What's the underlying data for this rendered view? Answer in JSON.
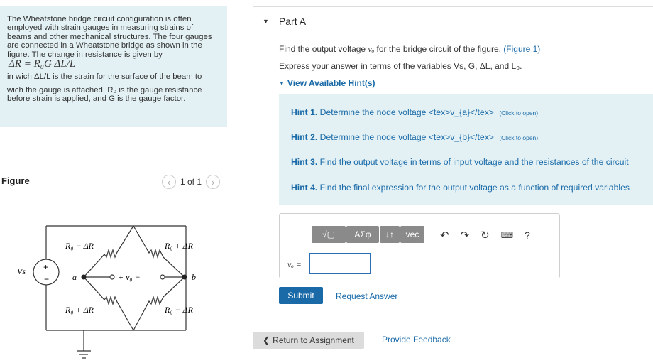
{
  "intro": {
    "lines": [
      "The Wheatstone bridge circuit configuration is often",
      "employed with strain gauges in measuring strains of",
      "beams and other mechanical structures. The four gauges",
      "are connected in a Wheatstone bridge as shown in the",
      "figure. The change in resistance is given by"
    ],
    "formula": "ΔR = R₀G ΔL/L",
    "after_formula": "in wich ΔL/L is the strain for the surface of the beam to",
    "lines2": [
      "wich the gauge is attached, R₀ is the gauge resistance",
      "before strain is applied, and G is the gauge factor."
    ]
  },
  "figure": {
    "label": "Figure",
    "pager": "1 of 1",
    "resistor_labels": [
      "R₀ − ΔR",
      "R₀ + ΔR",
      "R₀ + ΔR",
      "R₀ − ΔR"
    ],
    "node_a": "a",
    "node_b": "b",
    "vs": "Vs",
    "vo_label": "+ v₀ −"
  },
  "partA": {
    "title": "Part A",
    "question_pre": "Find the output voltage ",
    "question_var": "vₒ",
    "question_post": " for the bridge circuit of the figure. ",
    "figure_link": "(Figure 1)",
    "express": "Express your answer in terms of the variables Vs, G, ΔL, and L₀.",
    "hints_toggle": "View Available Hint(s)",
    "hints": [
      {
        "num": "Hint 1.",
        "text": "Determine the node voltage <tex>v_{a}</tex>",
        "note": "(Click to open)"
      },
      {
        "num": "Hint 2.",
        "text": "Determine the node voltage <tex>v_{b}</tex>",
        "note": "(Click to open)"
      },
      {
        "num": "Hint 3.",
        "text": "Find the output voltage in terms of input voltage and the resistances of the circuit",
        "note": ""
      },
      {
        "num": "Hint 4.",
        "text": "Find the final expression for the output voltage as a function of required variables",
        "note": ""
      }
    ],
    "toolbar": [
      "√▢",
      "ΑΣφ",
      "↓↑",
      "vec"
    ],
    "answer_label": "vₒ =",
    "submit": "Submit",
    "request": "Request Answer"
  },
  "footer": {
    "return": "Return to Assignment",
    "feedback": "Provide Feedback"
  },
  "colors": {
    "accent": "#1a6aa8",
    "panel": "#e3f1f4"
  }
}
